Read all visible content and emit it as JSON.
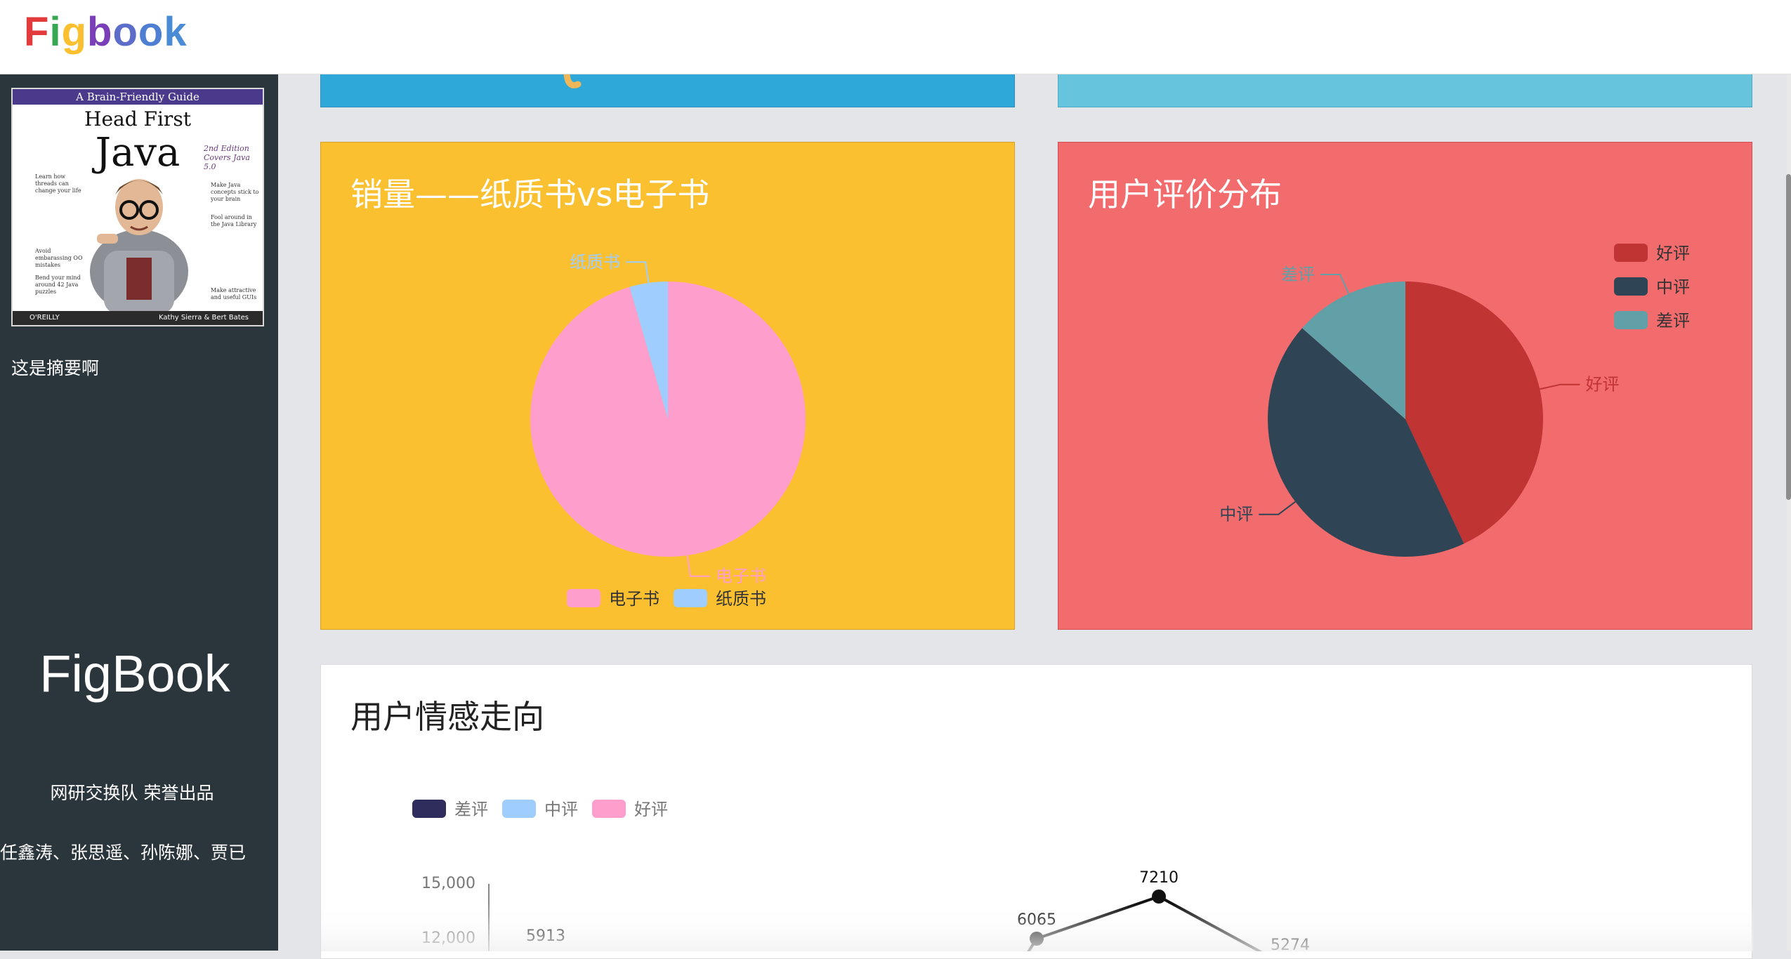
{
  "header": {
    "logo_letters": [
      {
        "ch": "F",
        "color": "#e33b3b"
      },
      {
        "ch": "i",
        "color": "#36a852"
      },
      {
        "ch": "g",
        "color": "#fbc02f"
      },
      {
        "ch": "b",
        "color": "#7a3fb8"
      },
      {
        "ch": "o",
        "color": "#5b6cc9"
      },
      {
        "ch": "o",
        "color": "#4e7fd2"
      },
      {
        "ch": "k",
        "color": "#4a8bd6"
      }
    ]
  },
  "sidebar": {
    "book_cover": {
      "top_banner": "A Brain-Friendly Guide",
      "title_line1": "Head First",
      "title_line2": "Java",
      "edition": "2nd Edition Covers Java 5.0",
      "publisher": "O'REILLY",
      "authors": "Kathy Sierra & Bert Bates"
    },
    "summary": "这是摘要啊",
    "brand": "FigBook",
    "team": "网研交换队 荣誉出品",
    "members": "任鑫涛、张思遥、孙陈娜、贾已"
  },
  "panels": {
    "sales": {
      "title": "销量——纸质书vs电子书",
      "color": "#fbc02f",
      "chart_data": {
        "type": "pie",
        "labels": [
          "电子书",
          "纸质书"
        ],
        "values": [
          95.5,
          4.5
        ],
        "colors": [
          "#fe9ecd",
          "#9ecdfe"
        ],
        "legend": [
          "电子书",
          "纸质书"
        ],
        "legend_position": "bottom"
      }
    },
    "rating": {
      "title": "用户评价分布",
      "color": "#f26b6d",
      "chart_data": {
        "type": "pie",
        "labels": [
          "好评",
          "中评",
          "差评"
        ],
        "values": [
          43,
          43.5,
          13.5
        ],
        "colors": [
          "#c03533",
          "#2f4555",
          "#62a0a7"
        ],
        "legend": [
          "好评",
          "中评",
          "差评"
        ],
        "legend_position": "top-right"
      }
    },
    "emotion": {
      "title": "用户情感走向",
      "chart_data": {
        "type": "line",
        "legend": [
          {
            "name": "差评",
            "color": "#2e2d5c"
          },
          {
            "name": "中评",
            "color": "#9ecdfe"
          },
          {
            "name": "好评",
            "color": "#fe9ecd"
          }
        ],
        "y_ticks": [
          "15,000",
          "12,000"
        ],
        "points": [
          {
            "label": "5913"
          },
          {
            "label": "6065"
          },
          {
            "label": "7210"
          },
          {
            "label": "5274"
          }
        ]
      }
    }
  }
}
